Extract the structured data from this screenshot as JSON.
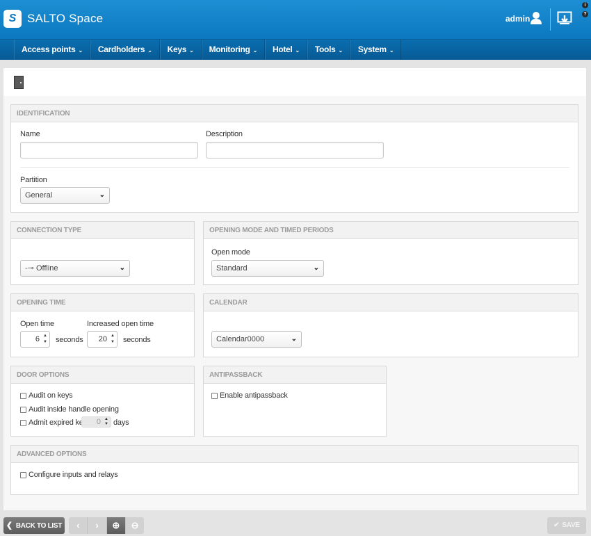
{
  "app": {
    "logo_letter": "S",
    "brand": "SALTO Space",
    "user": "admin"
  },
  "icons": [
    "user-icon",
    "download-icon",
    "info-icon",
    "door-icon",
    "chevron-down-icon",
    "spinner-arrows-icon",
    "offline-plug-icon",
    "chevron-left-icon",
    "chevron-right-icon",
    "plus-circle-icon",
    "minus-circle-icon",
    "check-icon"
  ],
  "colors": {
    "header": "#0b78bf",
    "nav": "#075a94"
  },
  "nav": [
    "Access points",
    "Cardholders",
    "Keys",
    "Monitoring",
    "Hotel",
    "Tools",
    "System"
  ],
  "identification": {
    "title": "IDENTIFICATION",
    "name_label": "Name",
    "name_value": "",
    "description_label": "Description",
    "description_value": "",
    "partition_label": "Partition",
    "partition_value": "General"
  },
  "connection": {
    "title": "CONNECTION TYPE",
    "value": "Offline"
  },
  "opening_mode": {
    "title": "OPENING MODE AND TIMED PERIODS",
    "open_mode_label": "Open mode",
    "open_mode_value": "Standard"
  },
  "opening_time": {
    "title": "OPENING TIME",
    "open_time_label": "Open time",
    "open_time_value": "6",
    "unit": "seconds",
    "increased_label": "Increased open time",
    "increased_value": "20",
    "increased_unit": "seconds"
  },
  "calendar": {
    "title": "CALENDAR",
    "value": "Calendar0000"
  },
  "door_options": {
    "title": "DOOR OPTIONS",
    "audit_keys": "Audit on keys",
    "audit_handle": "Audit inside handle opening",
    "admit_expired": "Admit expired keys",
    "expired_days_value": "0",
    "days_unit": "days"
  },
  "antipassback": {
    "title": "ANTIPASSBACK",
    "enable": "Enable antipassback"
  },
  "advanced": {
    "title": "ADVANCED OPTIONS",
    "configure": "Configure inputs and relays"
  },
  "footer": {
    "back": "BACK TO LIST",
    "save": "SAVE"
  }
}
